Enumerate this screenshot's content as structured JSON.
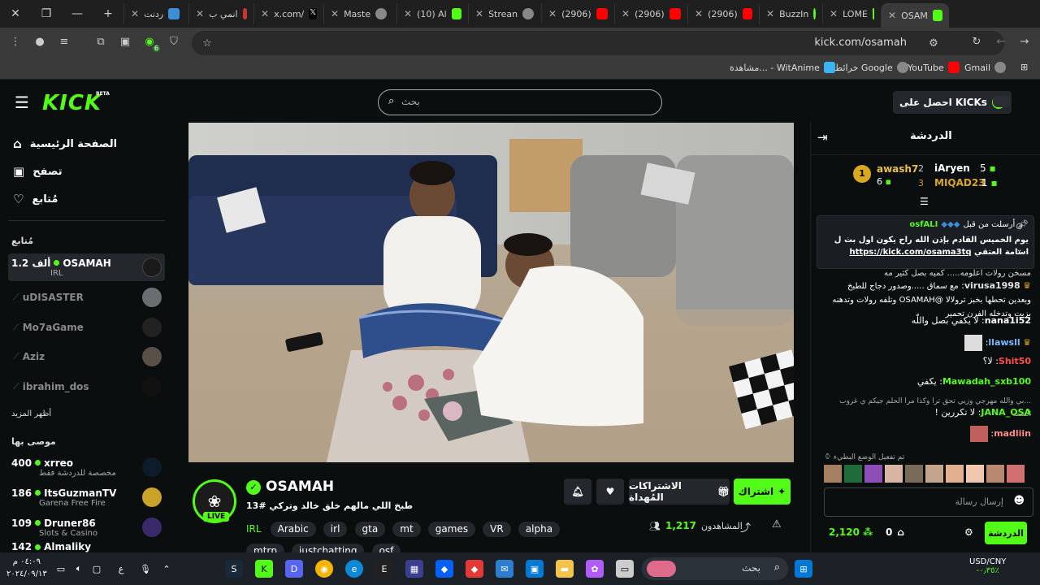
{
  "browser": {
    "tabs": [
      {
        "label": "OSAM",
        "active": true
      },
      {
        "label": "LOME"
      },
      {
        "label": "BuzzIn"
      },
      {
        "label": "(2906)"
      },
      {
        "label": "(2906)"
      },
      {
        "label": "(2906)"
      },
      {
        "label": "Strean"
      },
      {
        "label": "(10) Al"
      },
      {
        "label": "Maste"
      },
      {
        "label": "x.com/"
      },
      {
        "label": "انمي ب"
      },
      {
        "label": "ردنت"
      }
    ],
    "url": "kick.com/osamah",
    "bookmarks": [
      {
        "label": "Gmail"
      },
      {
        "label": "YouTube"
      },
      {
        "label": "خرائط Google"
      },
      {
        "label": "مشاهدة... - WitAnime"
      }
    ],
    "extension_badge": "6"
  },
  "header": {
    "logo": "KICK",
    "beta": "BETA",
    "search_placeholder": "بحث",
    "get_kicks": "احصل على KICKs"
  },
  "sidebar": {
    "nav": [
      {
        "label": "الصفحة الرئيسية"
      },
      {
        "label": "تصفح"
      },
      {
        "label": "مُتابع"
      }
    ],
    "following_title": "مُتابع",
    "following": [
      {
        "name": "OSAMAH",
        "sub": "IRL",
        "viewers": "1.2 ألف",
        "live": true
      },
      {
        "name": "uDISASTER",
        "live": false
      },
      {
        "name": "Mo7aGame",
        "live": false
      },
      {
        "name": "Aziz",
        "live": false
      },
      {
        "name": "ibrahim_dos",
        "live": false
      }
    ],
    "show_more": "أظهر المزيد",
    "recommended_title": "موصى بها",
    "recommended": [
      {
        "name": "xrreo",
        "sub": "مخصصة للدردشة فقط",
        "viewers": "400"
      },
      {
        "name": "ItsGuzmanTV",
        "sub": "Garena Free Fire",
        "viewers": "186"
      },
      {
        "name": "Druner86",
        "sub": "Slots & Casino",
        "viewers": "109"
      },
      {
        "name": "Almaliky",
        "sub": "",
        "viewers": "142"
      }
    ]
  },
  "channel": {
    "name": "OSAMAH",
    "title": "طبخ اللي مالهم خلق خالد وتركي #13",
    "live_badge": "LIVE",
    "tags": [
      "IRL",
      "Arabic",
      "irl",
      "gta",
      "mt",
      "games",
      "VR",
      "alpha",
      "mtrp",
      "justchatting",
      "osf"
    ],
    "subscribe_label": "اشتراك",
    "gift_label": "الاشتراكات المُهداة",
    "viewers_label": "المشاهدون",
    "viewers": "1,217"
  },
  "chat": {
    "title": "الدردشة",
    "leaders": [
      {
        "rank": "1",
        "name": "awash7",
        "count": "6"
      },
      {
        "rank": "2",
        "name": "iAryen",
        "count": "5"
      },
      {
        "rank": "3",
        "name": "MIQAD23",
        "count": "1"
      }
    ],
    "pinned": {
      "by_label": "أرسلت من قبل",
      "user": "osfALI",
      "text": "يوم الخميس القادم بإذن الله راح يكون اول بث ل اسامة العتقي",
      "link": "https://kick.com/osama3tq"
    },
    "messages": [
      {
        "user": "",
        "text": "مسخن رولات اعلومه..... كميه بصل كثير مه"
      },
      {
        "user": "virusa1998",
        "text": "مع سماق .....وصدور دجاج للطبخ وبعدين تحطها بخبز ترولالا @OSAMAH وتلفه رولات وتدهنه بزيت وتدخله الفرن تحمير",
        "color": "#e0e0e0"
      },
      {
        "user": "nana1i52",
        "text": "لا يكفي بصل واللّه",
        "color": "#ffffff"
      },
      {
        "user": "llawsll",
        "text": "",
        "color": "#7ab8ff"
      },
      {
        "user": "Shit50",
        "text": "لا؟",
        "color": "#ff4d4d"
      },
      {
        "user": "Mawadah_sxb100",
        "text": "يكفي",
        "color": "#53fc18"
      },
      {
        "user": "",
        "text": "...بي والله مهرجي وزيي تحق ترا وكذا مرا الحلم جيكم ي غروب الشمه"
      },
      {
        "user": "JANA_OSA",
        "text": "لا تكررين !",
        "color": "#53fc18"
      },
      {
        "user": "madliin",
        "text": "",
        "color": "#ff8a8a"
      }
    ],
    "slow_mode": "تم تفعيل الوضع البطيء",
    "input_placeholder": "إرسال رسالة",
    "points": "2,120",
    "kicks": "0",
    "chat_button": "الدردشة"
  },
  "taskbar": {
    "search": "بحث",
    "currency": "USD/CNY",
    "currency_change": "-٠٫٣٥٪",
    "time": "٠٤:٠٩ م",
    "date": "٢٠٢٤/٠٩/١٣",
    "lang": "ع"
  },
  "colors": {
    "brand": "#53fc18",
    "bg": "#0b0e0f",
    "panel": "#24272c"
  }
}
